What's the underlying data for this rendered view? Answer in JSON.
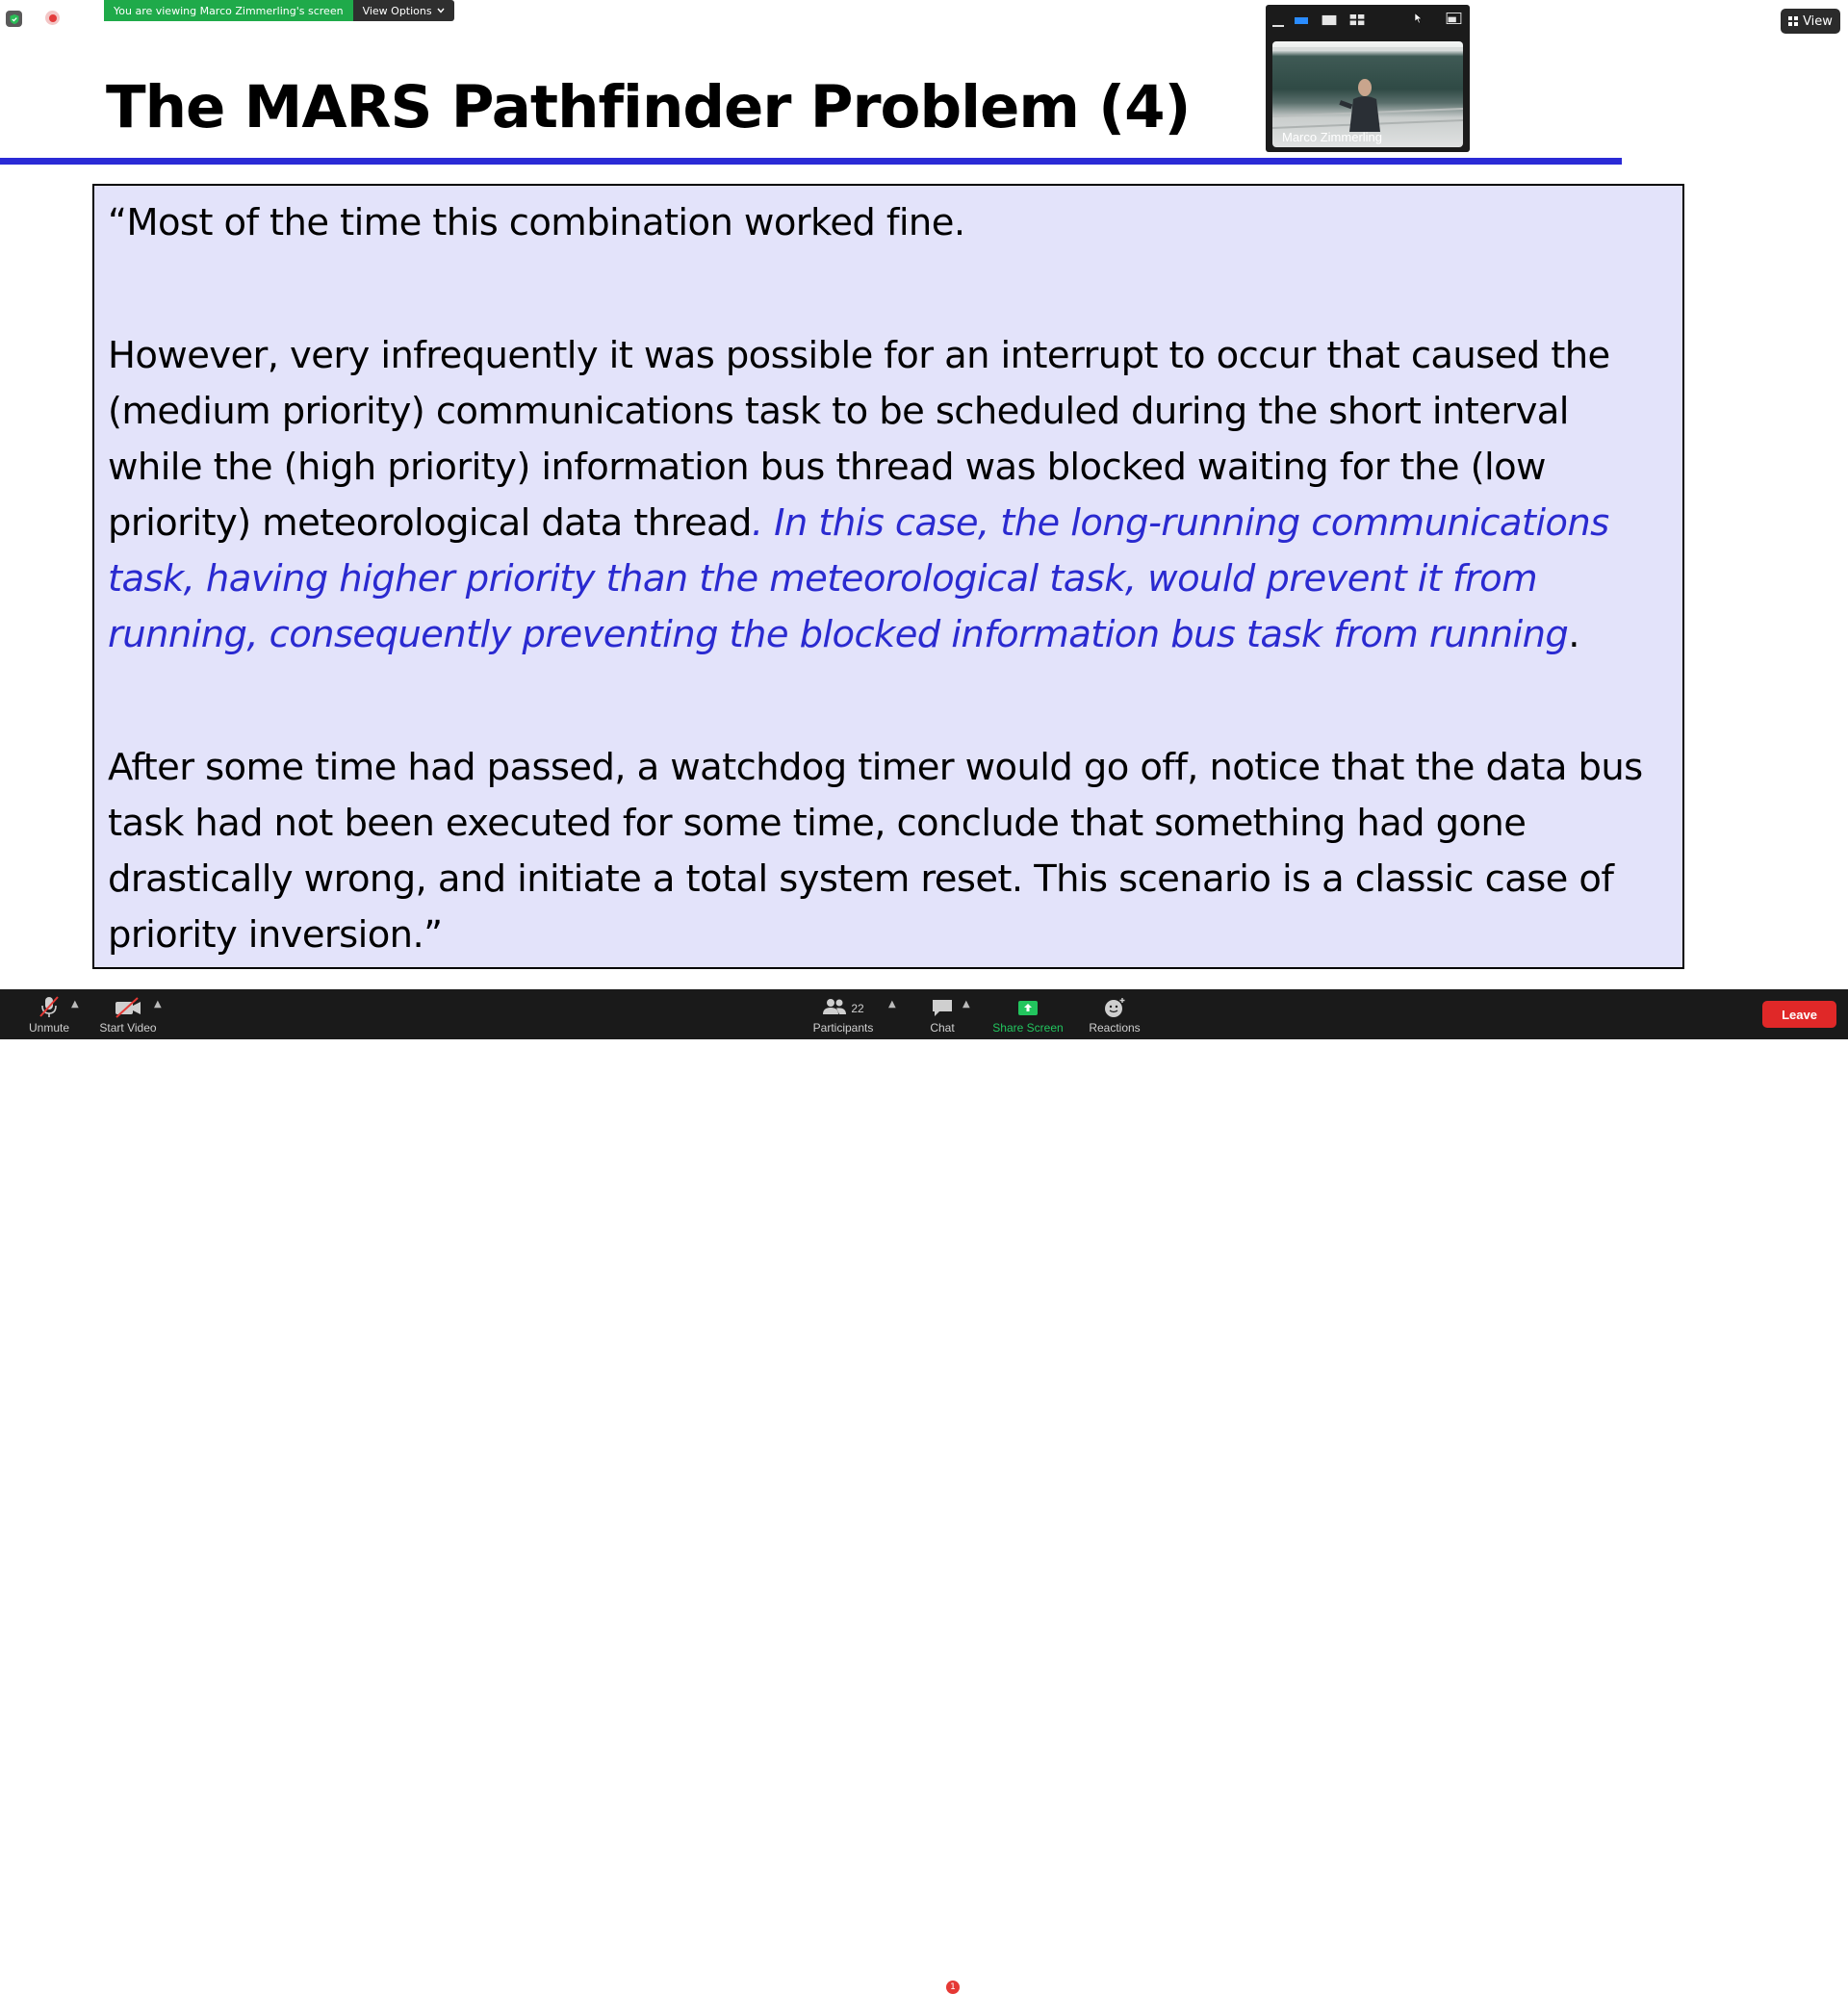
{
  "banner": {
    "viewing_text": "You are viewing Marco Zimmerling's screen",
    "options_label": "View Options"
  },
  "slide": {
    "title": "The MARS Pathfinder Problem (4)",
    "para1": "“Most of the time this combination worked fine.",
    "para2_plain": "However, very infrequently it was possible for an interrupt to occur that caused the (medium priority) communications task to be scheduled during the short interval while the (high priority) information bus thread was blocked waiting for the (low priority) meteorological data thread",
    "para2_dot": ".",
    "para2_highlight": " In this case, the long-running communications task, having higher priority than the meteorological task, would prevent it from running, consequently preventing the blocked information bus task from running",
    "para2_end": ".",
    "para3": "After some time had passed, a watchdog timer would go off, notice that the data bus task had not been executed for some time, conclude that something had gone drastically wrong, and initiate a total system reset. This scenario is a classic case of priority inversion.”",
    "highlight_color": "#2a2ad0",
    "rule_color": "#2a2ad6",
    "box_color": "#e3e3fa"
  },
  "thumbnail": {
    "participant_name": "Marco Zimmerling"
  },
  "view_button": {
    "label": "View"
  },
  "toolbar": {
    "unmute_label": "Unmute",
    "start_video_label": "Start Video",
    "participants_label": "Participants",
    "participants_count": "22",
    "chat_label": "Chat",
    "chat_badge": "1",
    "share_label": "Share Screen",
    "reactions_label": "Reactions",
    "leave_label": "Leave",
    "share_color": "#22c55e",
    "leave_color": "#e02828"
  }
}
